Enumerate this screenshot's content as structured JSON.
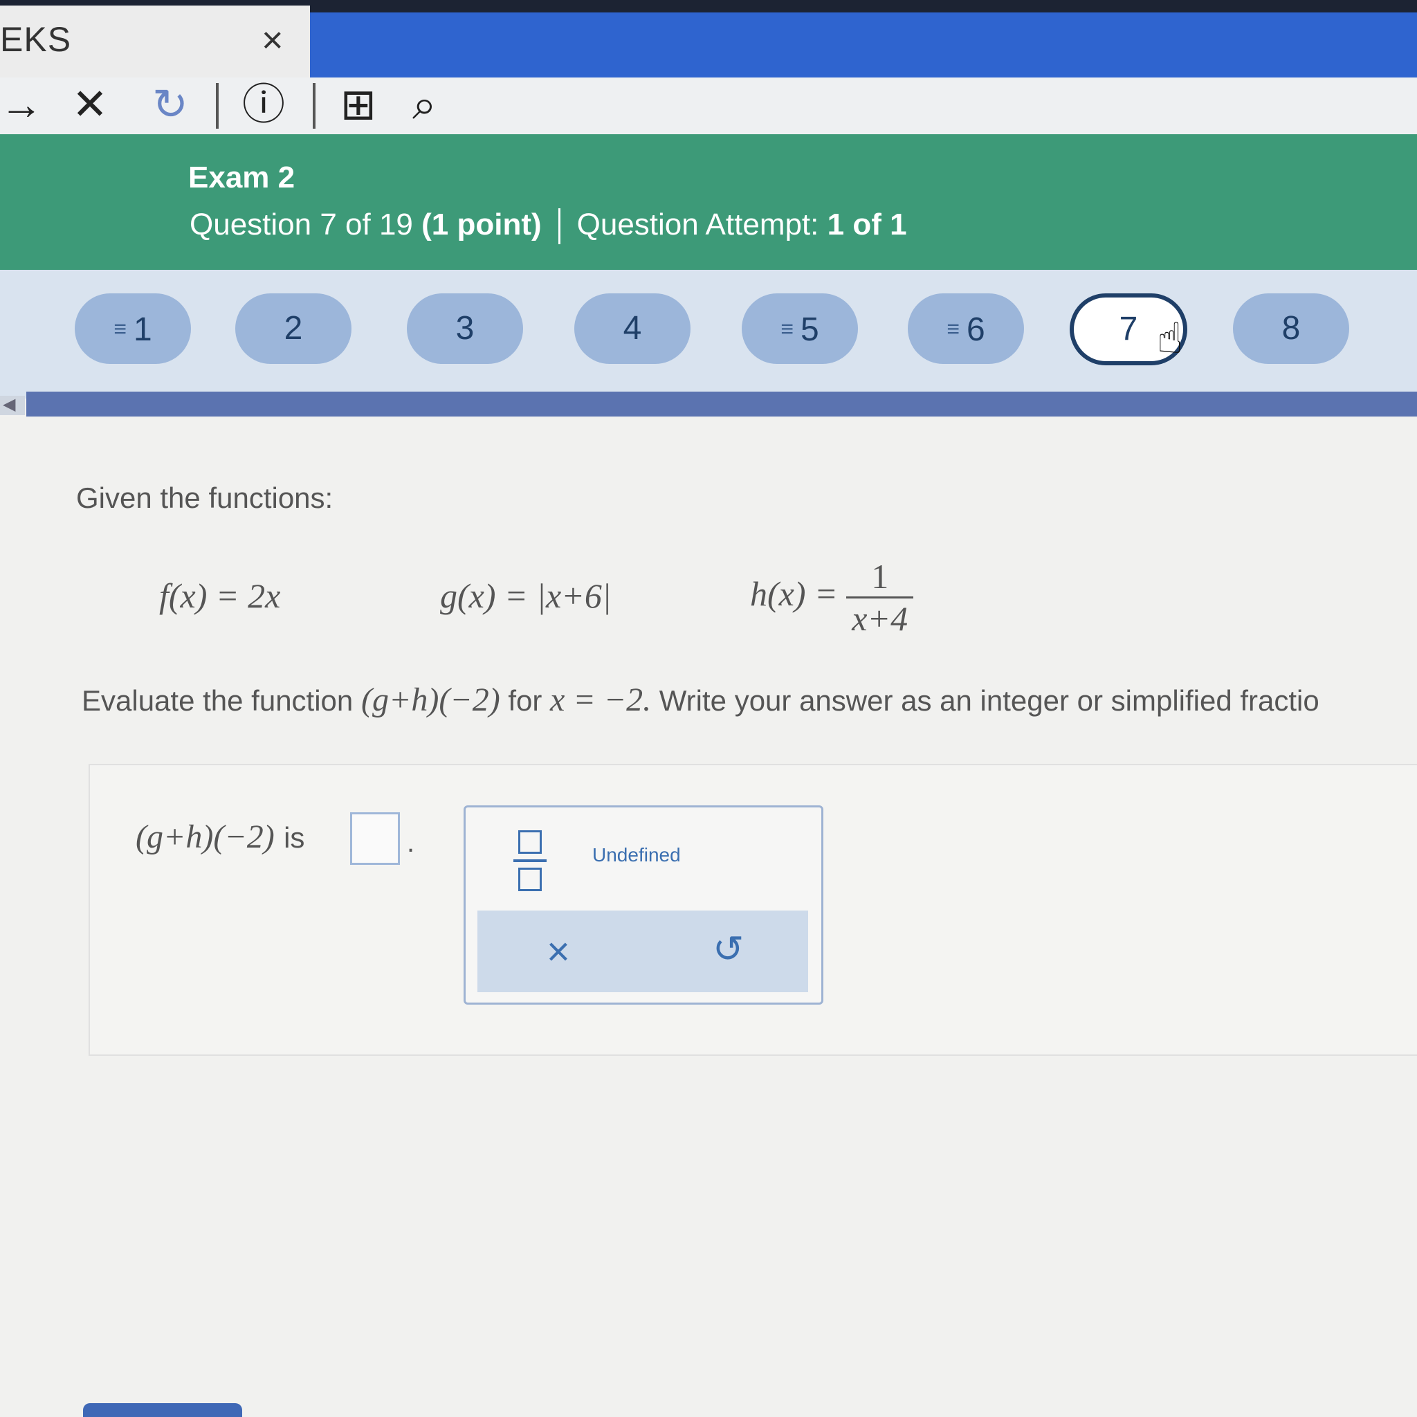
{
  "browser": {
    "tab_title": "EKS",
    "tab_close": "×",
    "toolbar": {
      "forward_icon": "→",
      "stop_icon": "✕",
      "reload_icon": "↻",
      "info_icon": "ⓘ",
      "add_page_icon": "⊞",
      "search_icon": "⌕"
    }
  },
  "header": {
    "title": "Exam 2",
    "question_label": "Question 7 of 19",
    "points": "(1 point)",
    "attempt_label": "Question Attempt:",
    "attempt_value": "1 of 1"
  },
  "question_nav": {
    "items": [
      {
        "label": "1",
        "flagged": true
      },
      {
        "label": "2",
        "flagged": false
      },
      {
        "label": "3",
        "flagged": false
      },
      {
        "label": "4",
        "flagged": false
      },
      {
        "label": "5",
        "flagged": true
      },
      {
        "label": "6",
        "flagged": true
      },
      {
        "label": "7",
        "flagged": false,
        "active": true
      },
      {
        "label": "8",
        "flagged": false
      }
    ],
    "flag_glyph": "≡"
  },
  "question": {
    "given": "Given the functions:",
    "f": "f(x) = 2x",
    "g": "g(x) = |x+6|",
    "h_lhs": "h(x) =",
    "h_num": "1",
    "h_den": "x+4",
    "instruction_start": "Evaluate the function",
    "instruction_expr": "(g+h)(−2)",
    "instruction_mid": "for",
    "instruction_cond": "x = −2.",
    "instruction_end": "Write your answer as an integer or simplified fractio"
  },
  "answer": {
    "expr": "(g+h)(−2)",
    "is_word": "is",
    "value": "",
    "dot": ".",
    "undefined_label": "Undefined",
    "clear_icon": "×",
    "undo_icon": "↺"
  },
  "colors": {
    "header_green": "#3d9a78",
    "nav_pill": "#9cb6da",
    "accent_blue": "#3b6fb0"
  }
}
